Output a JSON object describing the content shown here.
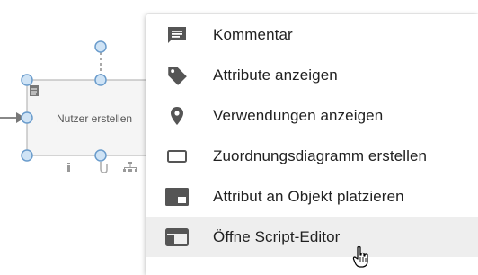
{
  "diagram": {
    "node_label": "Nutzer erstellen"
  },
  "menu": {
    "items": [
      {
        "label": "Kommentar",
        "icon": "comment-icon"
      },
      {
        "label": "Attribute anzeigen",
        "icon": "tag-icon"
      },
      {
        "label": "Verwendungen anzeigen",
        "icon": "location-pin-icon"
      },
      {
        "label": "Zuordnungsdiagramm erstellen",
        "icon": "rectangle-outline-icon"
      },
      {
        "label": "Attribut an Objekt platzieren",
        "icon": "picture-in-picture-icon"
      },
      {
        "label": "Öffne Script-Editor",
        "icon": "web-window-icon"
      }
    ],
    "hovered_index": 5
  },
  "colors": {
    "icon": "#555555",
    "hover_bg": "#eeeeee",
    "handle_fill": "#cfe3f5",
    "handle_stroke": "#6a9ccc"
  }
}
